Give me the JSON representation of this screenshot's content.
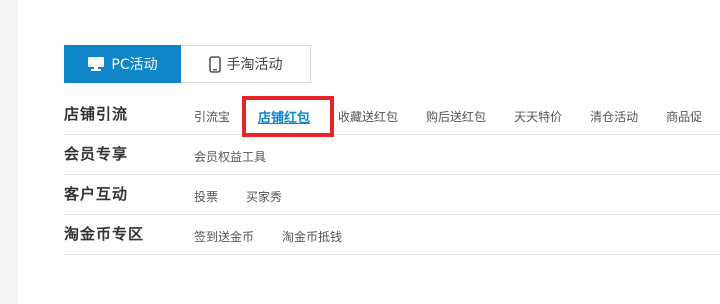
{
  "tabs": [
    {
      "label": "PC活动",
      "icon": "monitor-icon",
      "active": true
    },
    {
      "label": "手淘活动",
      "icon": "phone-icon",
      "active": false
    }
  ],
  "categories": [
    {
      "title": "店铺引流",
      "items": [
        "引流宝",
        "店铺红包",
        "收藏送红包",
        "购后送红包",
        "天天特价",
        "清仓活动",
        "商品促"
      ]
    },
    {
      "title": "会员专享",
      "items": [
        "会员权益工具"
      ]
    },
    {
      "title": "客户互动",
      "items": [
        "投票",
        "买家秀"
      ]
    },
    {
      "title": "淘金币专区",
      "items": [
        "签到送金币",
        "淘金币抵钱"
      ]
    }
  ],
  "colors": {
    "accent": "#0f86c8",
    "highlight": "#e8232a"
  }
}
